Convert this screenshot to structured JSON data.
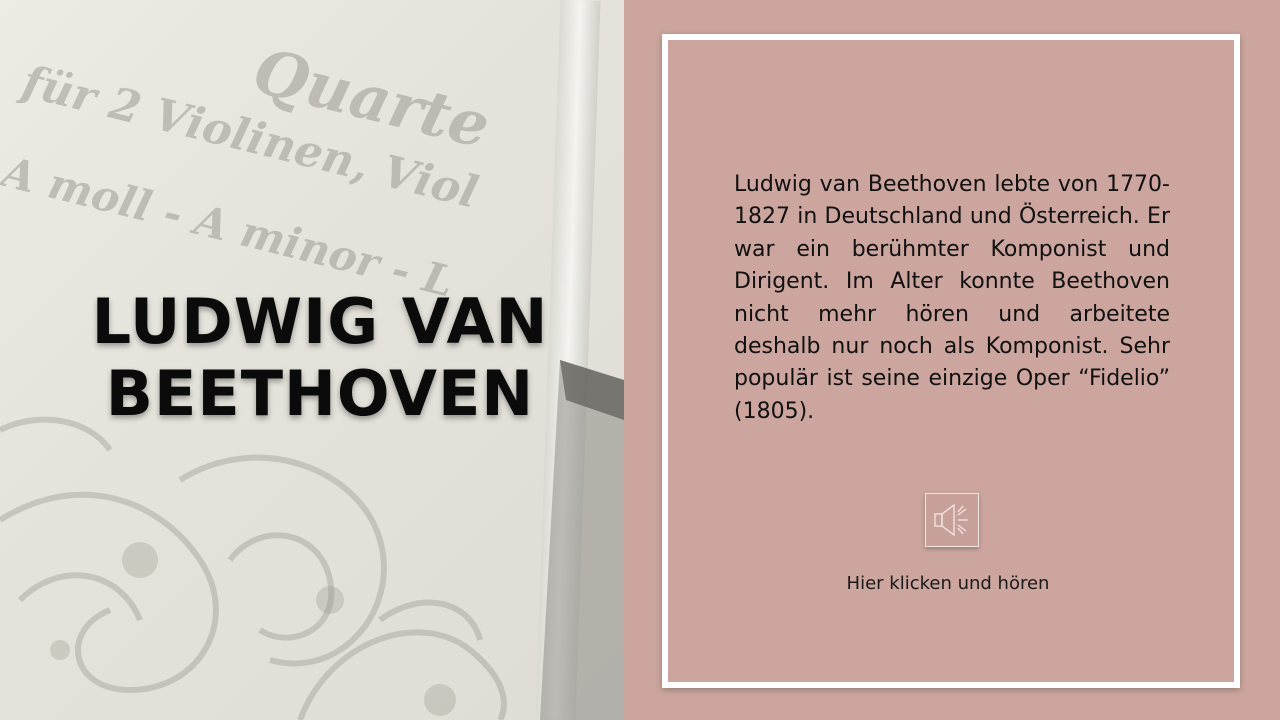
{
  "slide": {
    "title_line1": "LUDWIG VAN",
    "title_line2": "BEETHOVEN",
    "body_text": "Ludwig van Beethoven lebte von 1770-1827 in Deutschland und Österreich. Er war ein berühmter Komponist und Dirigent. Im Alter konnte Beethoven nicht mehr hören und arbeitete deshalb nur noch als Komponist. Sehr populär ist seine einzige Oper “Fidelio” (1805).",
    "audio": {
      "icon": "speaker-icon",
      "label": "Hier klicken und hören"
    },
    "background_text": {
      "line1": "Quarte",
      "line2": "für 2 Violinen, Viol",
      "line3": "A moll - A minor - L"
    }
  },
  "colors": {
    "panel": "#cba59e",
    "frame": "#ffffff",
    "title": "#0b0b0b",
    "body": "#111111"
  }
}
